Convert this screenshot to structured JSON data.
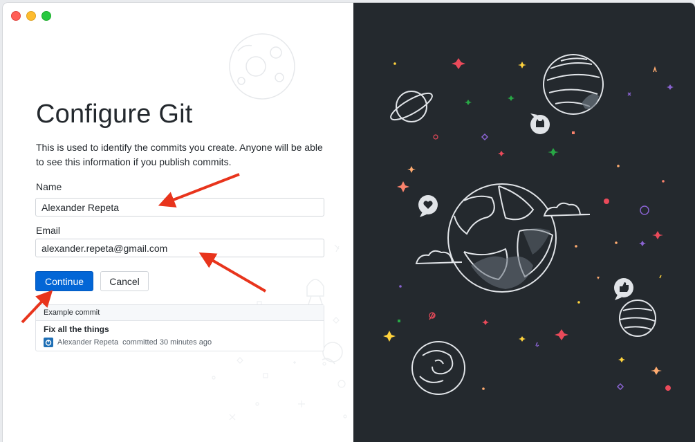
{
  "window": {
    "controls": [
      "close",
      "minimize",
      "zoom"
    ]
  },
  "page": {
    "title": "Configure Git",
    "description": "This is used to identify the commits you create. Anyone will be able to see this information if you publish commits."
  },
  "form": {
    "name_label": "Name",
    "name_value": "Alexander Repeta",
    "email_label": "Email",
    "email_value": "alexander.repeta@gmail.com",
    "continue_label": "Continue",
    "cancel_label": "Cancel"
  },
  "example_commit": {
    "header": "Example commit",
    "summary": "Fix all the things",
    "author": "Alexander Repeta",
    "meta": "committed 30 minutes ago"
  },
  "colors": {
    "primary_button": "#0366d6",
    "annotation_arrow": "#e8341c",
    "dark_panel": "#24292e",
    "text": "#24292e"
  },
  "icons": [
    "moon-icon",
    "planet-icon",
    "earth-icon",
    "heart-bubble-icon",
    "thumbs-up-bubble-icon",
    "octocat-bubble-icon",
    "rocket-icon",
    "avatar-icon"
  ]
}
